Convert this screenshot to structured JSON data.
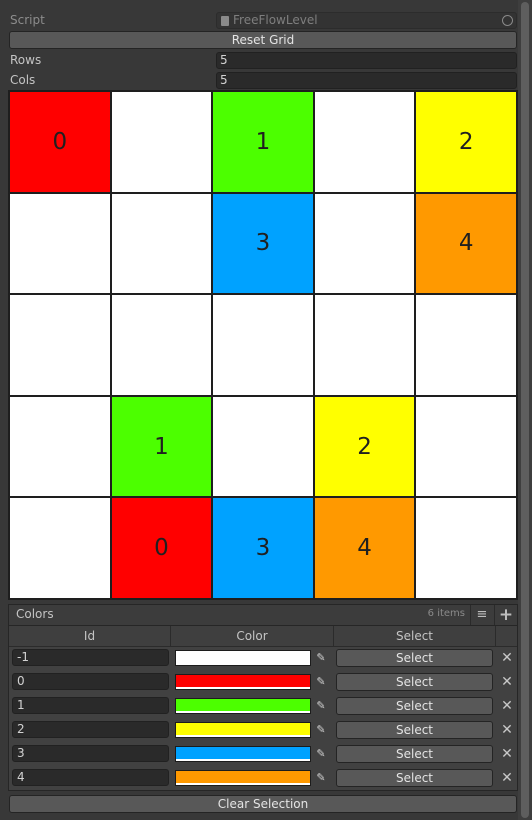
{
  "inspector": {
    "script_label": "Script",
    "script_value": "FreeFlowLevel",
    "reset_label": "Reset Grid",
    "rows_label": "Rows",
    "rows_value": "5",
    "cols_label": "Cols",
    "cols_value": "5"
  },
  "grid": {
    "cells": [
      {
        "label": "0",
        "color": "#ff0000"
      },
      {
        "label": "",
        "color": "#ffffff"
      },
      {
        "label": "1",
        "color": "#4cff00"
      },
      {
        "label": "",
        "color": "#ffffff"
      },
      {
        "label": "2",
        "color": "#ffff00"
      },
      {
        "label": "",
        "color": "#ffffff"
      },
      {
        "label": "",
        "color": "#ffffff"
      },
      {
        "label": "3",
        "color": "#00a2ff"
      },
      {
        "label": "",
        "color": "#ffffff"
      },
      {
        "label": "4",
        "color": "#ff9900"
      },
      {
        "label": "",
        "color": "#ffffff"
      },
      {
        "label": "",
        "color": "#ffffff"
      },
      {
        "label": "",
        "color": "#ffffff"
      },
      {
        "label": "",
        "color": "#ffffff"
      },
      {
        "label": "",
        "color": "#ffffff"
      },
      {
        "label": "",
        "color": "#ffffff"
      },
      {
        "label": "1",
        "color": "#4cff00"
      },
      {
        "label": "",
        "color": "#ffffff"
      },
      {
        "label": "2",
        "color": "#ffff00"
      },
      {
        "label": "",
        "color": "#ffffff"
      },
      {
        "label": "",
        "color": "#ffffff"
      },
      {
        "label": "0",
        "color": "#ff0000"
      },
      {
        "label": "3",
        "color": "#00a2ff"
      },
      {
        "label": "4",
        "color": "#ff9900"
      },
      {
        "label": "",
        "color": "#ffffff"
      }
    ]
  },
  "colors_list": {
    "title": "Colors",
    "count": "6 items",
    "headers": [
      "Id",
      "Color",
      "Select"
    ],
    "rows": [
      {
        "id": "-1",
        "color": "#ffffff",
        "select": "Select"
      },
      {
        "id": "0",
        "color": "#ff0000",
        "select": "Select"
      },
      {
        "id": "1",
        "color": "#4cff00",
        "select": "Select"
      },
      {
        "id": "2",
        "color": "#ffff00",
        "select": "Select"
      },
      {
        "id": "3",
        "color": "#00a2ff",
        "select": "Select"
      },
      {
        "id": "4",
        "color": "#ff9900",
        "select": "Select"
      }
    ]
  },
  "clear_label": "Clear Selection",
  "icons": {
    "script_file": "script-file-icon",
    "object_picker": "object-picker-icon",
    "list_menu": "list-menu-icon",
    "add": "plus-icon",
    "eyedropper": "eyedropper-icon",
    "remove": "remove-x-icon"
  }
}
